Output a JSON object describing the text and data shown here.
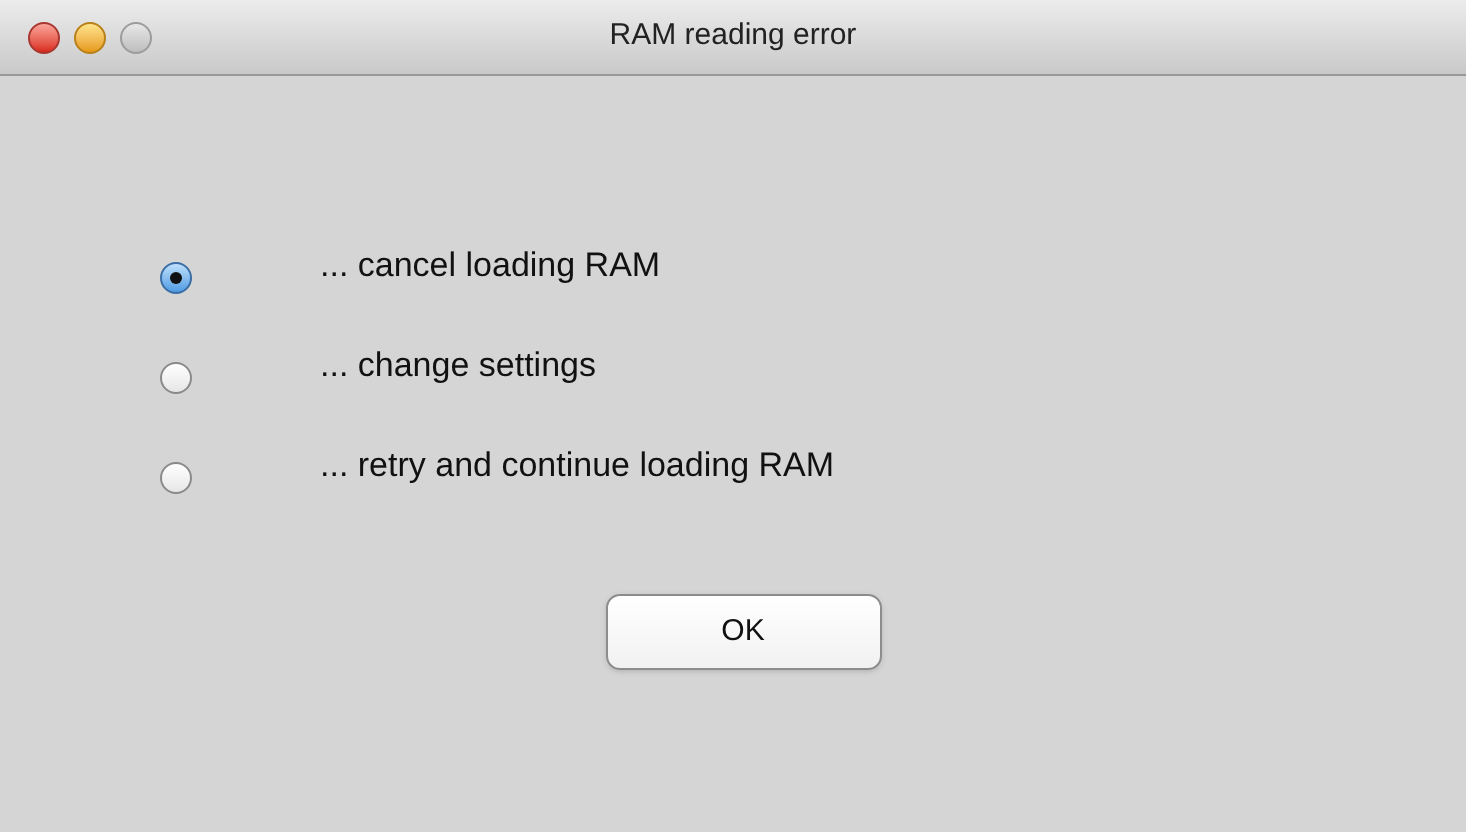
{
  "window": {
    "title": "RAM reading error"
  },
  "options": [
    {
      "label": "... cancel loading RAM",
      "selected": true
    },
    {
      "label": "... change settings",
      "selected": false
    },
    {
      "label": "... retry and continue loading RAM",
      "selected": false
    }
  ],
  "buttons": [
    "OK"
  ]
}
